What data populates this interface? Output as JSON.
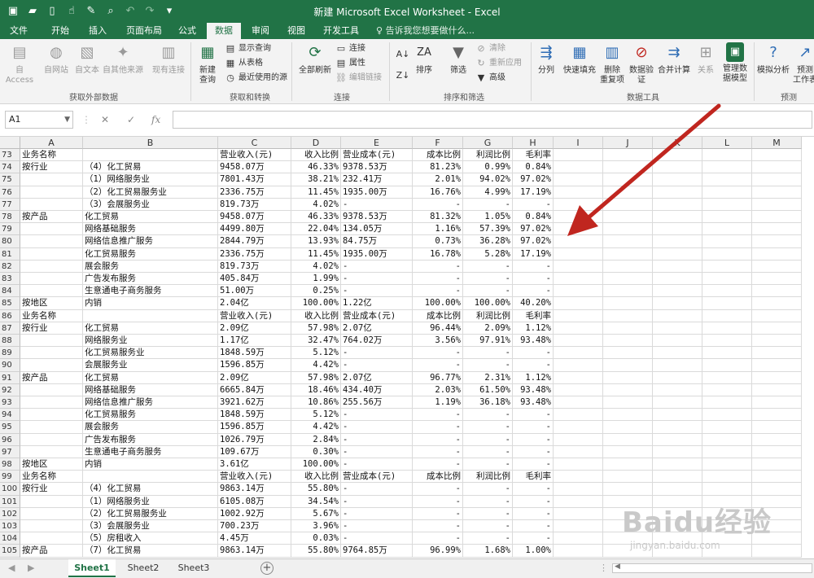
{
  "window": {
    "title": "新建 Microsoft Excel Worksheet - Excel"
  },
  "qat_icons": [
    "save-icon",
    "open-icon",
    "new-icon",
    "touch-mode-icon",
    "format-painter-icon",
    "print-preview-icon",
    "undo-icon",
    "redo-icon"
  ],
  "ribbon_tabs": [
    "文件",
    "开始",
    "插入",
    "页面布局",
    "公式",
    "数据",
    "审阅",
    "视图",
    "开发工具"
  ],
  "active_tab": "数据",
  "tell_me": "告诉我您想要做什么...",
  "groups": {
    "external": {
      "label": "获取外部数据",
      "buttons": [
        "自 Access",
        "自网站",
        "自文本",
        "自其他来源",
        "现有连接"
      ]
    },
    "transform": {
      "label": "获取和转换",
      "new_query": "新建\n查询",
      "small": [
        "显示查询",
        "从表格",
        "最近使用的源"
      ]
    },
    "connections": {
      "label": "连接",
      "refresh": "全部刷新",
      "small": [
        "连接",
        "属性",
        "编辑链接"
      ]
    },
    "sort": {
      "label": "排序和筛选",
      "sort": "排序",
      "filter": "筛选",
      "small": [
        "清除",
        "重新应用",
        "高级"
      ]
    },
    "tools": {
      "label": "数据工具",
      "buttons": [
        "分列",
        "快速填充",
        "删除\n重复项",
        "数据验\n证",
        "合并计算",
        "关系",
        "管理数\n据模型"
      ]
    },
    "forecast": {
      "label": "预测",
      "buttons": [
        "模拟分析",
        "预测\n工作表"
      ]
    }
  },
  "formula_bar": {
    "name_box": "A1",
    "fx": "fx",
    "content": ""
  },
  "columns": [
    "A",
    "B",
    "C",
    "D",
    "E",
    "F",
    "G",
    "H",
    "I",
    "J",
    "K",
    "L",
    "M"
  ],
  "rows": [
    {
      "n": "73",
      "A": "业务名称",
      "B": "",
      "C": "营业收入(元)",
      "D": "收入比例",
      "E": "营业成本(元)",
      "F": "成本比例",
      "G": "利润比例",
      "H": "毛利率"
    },
    {
      "n": "74",
      "A": "按行业",
      "B": "（4）化工贸易",
      "C": "9458.07万",
      "D": "46.33%",
      "E": "9378.53万",
      "F": "81.23%",
      "G": "0.99%",
      "H": "0.84%"
    },
    {
      "n": "75",
      "A": "",
      "B": "（1）网络服务业",
      "C": "7801.43万",
      "D": "38.21%",
      "E": "232.41万",
      "F": "2.01%",
      "G": "94.02%",
      "H": "97.02%"
    },
    {
      "n": "76",
      "A": "",
      "B": "（2）化工贸易服务业",
      "C": "2336.75万",
      "D": "11.45%",
      "E": "1935.00万",
      "F": "16.76%",
      "G": "4.99%",
      "H": "17.19%"
    },
    {
      "n": "77",
      "A": "",
      "B": "（3）会展服务业",
      "C": "819.73万",
      "D": "4.02%",
      "E": "-",
      "F": "-",
      "G": "-",
      "H": "-"
    },
    {
      "n": "78",
      "A": "按产品",
      "B": "化工贸易",
      "C": "9458.07万",
      "D": "46.33%",
      "E": "9378.53万",
      "F": "81.32%",
      "G": "1.05%",
      "H": "0.84%"
    },
    {
      "n": "79",
      "A": "",
      "B": "网络基础服务",
      "C": "4499.80万",
      "D": "22.04%",
      "E": "134.05万",
      "F": "1.16%",
      "G": "57.39%",
      "H": "97.02%"
    },
    {
      "n": "80",
      "A": "",
      "B": "网络信息推广服务",
      "C": "2844.79万",
      "D": "13.93%",
      "E": "84.75万",
      "F": "0.73%",
      "G": "36.28%",
      "H": "97.02%"
    },
    {
      "n": "81",
      "A": "",
      "B": "化工贸易服务",
      "C": "2336.75万",
      "D": "11.45%",
      "E": "1935.00万",
      "F": "16.78%",
      "G": "5.28%",
      "H": "17.19%"
    },
    {
      "n": "82",
      "A": "",
      "B": "展会服务",
      "C": "819.73万",
      "D": "4.02%",
      "E": "-",
      "F": "-",
      "G": "-",
      "H": "-"
    },
    {
      "n": "83",
      "A": "",
      "B": "广告发布服务",
      "C": "405.84万",
      "D": "1.99%",
      "E": "-",
      "F": "-",
      "G": "-",
      "H": "-"
    },
    {
      "n": "84",
      "A": "",
      "B": "生意通电子商务服务",
      "C": "51.00万",
      "D": "0.25%",
      "E": "-",
      "F": "-",
      "G": "-",
      "H": "-"
    },
    {
      "n": "85",
      "A": "按地区",
      "B": "内销",
      "C": "2.04亿",
      "D": "100.00%",
      "E": "1.22亿",
      "F": "100.00%",
      "G": "100.00%",
      "H": "40.20%"
    },
    {
      "n": "86",
      "A": "业务名称",
      "B": "",
      "C": "营业收入(元)",
      "D": "收入比例",
      "E": "营业成本(元)",
      "F": "成本比例",
      "G": "利润比例",
      "H": "毛利率"
    },
    {
      "n": "87",
      "A": "按行业",
      "B": "化工贸易",
      "C": "2.09亿",
      "D": "57.98%",
      "E": "2.07亿",
      "F": "96.44%",
      "G": "2.09%",
      "H": "1.12%"
    },
    {
      "n": "88",
      "A": "",
      "B": "网络服务业",
      "C": "1.17亿",
      "D": "32.47%",
      "E": "764.02万",
      "F": "3.56%",
      "G": "97.91%",
      "H": "93.48%"
    },
    {
      "n": "89",
      "A": "",
      "B": "化工贸易服务业",
      "C": "1848.59万",
      "D": "5.12%",
      "E": "-",
      "F": "-",
      "G": "-",
      "H": "-"
    },
    {
      "n": "90",
      "A": "",
      "B": "会展服务业",
      "C": "1596.85万",
      "D": "4.42%",
      "E": "-",
      "F": "-",
      "G": "-",
      "H": "-"
    },
    {
      "n": "91",
      "A": "按产品",
      "B": "化工贸易",
      "C": "2.09亿",
      "D": "57.98%",
      "E": "2.07亿",
      "F": "96.77%",
      "G": "2.31%",
      "H": "1.12%"
    },
    {
      "n": "92",
      "A": "",
      "B": "网络基础服务",
      "C": "6665.84万",
      "D": "18.46%",
      "E": "434.40万",
      "F": "2.03%",
      "G": "61.50%",
      "H": "93.48%"
    },
    {
      "n": "93",
      "A": "",
      "B": "网络信息推广服务",
      "C": "3921.62万",
      "D": "10.86%",
      "E": "255.56万",
      "F": "1.19%",
      "G": "36.18%",
      "H": "93.48%"
    },
    {
      "n": "94",
      "A": "",
      "B": "化工贸易服务",
      "C": "1848.59万",
      "D": "5.12%",
      "E": "-",
      "F": "-",
      "G": "-",
      "H": "-"
    },
    {
      "n": "95",
      "A": "",
      "B": "展会服务",
      "C": "1596.85万",
      "D": "4.42%",
      "E": "-",
      "F": "-",
      "G": "-",
      "H": "-"
    },
    {
      "n": "96",
      "A": "",
      "B": "广告发布服务",
      "C": "1026.79万",
      "D": "2.84%",
      "E": "-",
      "F": "-",
      "G": "-",
      "H": "-"
    },
    {
      "n": "97",
      "A": "",
      "B": "生意通电子商务服务",
      "C": "109.67万",
      "D": "0.30%",
      "E": "-",
      "F": "-",
      "G": "-",
      "H": "-"
    },
    {
      "n": "98",
      "A": "按地区",
      "B": "内销",
      "C": "3.61亿",
      "D": "100.00%",
      "E": "-",
      "F": "-",
      "G": "-",
      "H": "-"
    },
    {
      "n": "99",
      "A": "业务名称",
      "B": "",
      "C": "营业收入(元)",
      "D": "收入比例",
      "E": "营业成本(元)",
      "F": "成本比例",
      "G": "利润比例",
      "H": "毛利率"
    },
    {
      "n": "100",
      "A": "按行业",
      "B": "（4）化工贸易",
      "C": "9863.14万",
      "D": "55.80%",
      "E": "-",
      "F": "-",
      "G": "-",
      "H": "-"
    },
    {
      "n": "101",
      "A": "",
      "B": "（1）网络服务业",
      "C": "6105.08万",
      "D": "34.54%",
      "E": "-",
      "F": "-",
      "G": "-",
      "H": "-"
    },
    {
      "n": "102",
      "A": "",
      "B": "（2）化工贸易服务业",
      "C": "1002.92万",
      "D": "5.67%",
      "E": "-",
      "F": "-",
      "G": "-",
      "H": "-"
    },
    {
      "n": "103",
      "A": "",
      "B": "（3）会展服务业",
      "C": "700.23万",
      "D": "3.96%",
      "E": "-",
      "F": "-",
      "G": "-",
      "H": "-"
    },
    {
      "n": "104",
      "A": "",
      "B": "（5）房租收入",
      "C": "4.45万",
      "D": "0.03%",
      "E": "-",
      "F": "-",
      "G": "-",
      "H": "-"
    },
    {
      "n": "105",
      "A": "按产品",
      "B": "（7）化工贸易",
      "C": "9863.14万",
      "D": "55.80%",
      "E": "9764.85万",
      "F": "96.99%",
      "G": "1.68%",
      "H": "1.00%"
    }
  ],
  "sheets": [
    "Sheet1",
    "Sheet2",
    "Sheet3"
  ],
  "active_sheet": "Sheet1",
  "watermark": {
    "text": "Baidu经验",
    "url": "jingyan.baidu.com"
  },
  "colors": {
    "accent": "#217346",
    "arrow": "#c0261f"
  }
}
